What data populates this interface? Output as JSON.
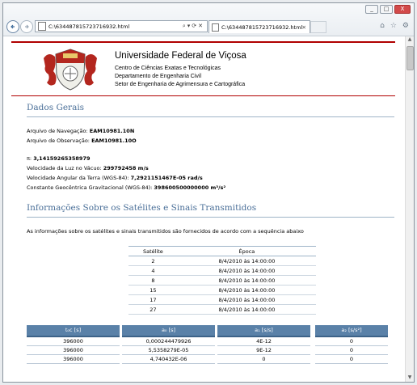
{
  "browser": {
    "address_url": "C:\\63448781572371693​2.html",
    "tab_title": "C:\\634487815723716932.html",
    "window_buttons": [
      "_",
      "□",
      "X"
    ]
  },
  "header": {
    "university": "Universidade Federal de Viçosa",
    "lines": [
      "Centro de Ciências Exatas e Tecnológicas",
      "Departamento de Engenharia Civil",
      "Setor de Engenharia de Agrimensura e Cartográfica"
    ]
  },
  "dados_gerais": {
    "title": "Dados Gerais",
    "nav_label": "Arquivo de Navegação:",
    "nav_value": "EAM10981.10N",
    "obs_label": "Arquivo de Observação:",
    "obs_value": "EAM10981.10O",
    "pi_label": "π:",
    "pi_value": "3,14159265358979",
    "c_label": "Velocidade da Luz no Vácuo:",
    "c_value": "299792458 m/s",
    "w_label": "Velocidade Angular da Terra (WGS-84):",
    "w_value": "7,2921151467E-05 rad/s",
    "gm_label": "Constante Geocêntrica Gravitacional (WGS-84):",
    "gm_value": "398600500000000 m³/s²"
  },
  "satelites": {
    "title": "Informações Sobre os Satélites e Sinais Transmitidos",
    "intro": "As informações sobre os satélites e sinais transmitidos são fornecidos de acordo com a sequência abaixo",
    "headers": [
      "Satélite",
      "Época"
    ],
    "rows": [
      [
        "2",
        "8/4/2010 às 14:00:00"
      ],
      [
        "4",
        "8/4/2010 às 14:00:00"
      ],
      [
        "8",
        "8/4/2010 às 14:00:00"
      ],
      [
        "15",
        "8/4/2010 às 14:00:00"
      ],
      [
        "17",
        "8/4/2010 às 14:00:00"
      ],
      [
        "27",
        "8/4/2010 às 14:00:00"
      ]
    ]
  },
  "coeficientes": {
    "headers": [
      "t₀c [s]",
      "a₀ [s]",
      "a₁ [s/s]",
      "a₂ [s/s²]"
    ],
    "rows": [
      [
        "396000",
        "0,000244479926",
        "4E-12",
        "0"
      ],
      [
        "396000",
        "5,5358279E-05",
        "9E-12",
        "0"
      ],
      [
        "396000",
        "4,740432E-06",
        "0",
        "0"
      ]
    ]
  }
}
